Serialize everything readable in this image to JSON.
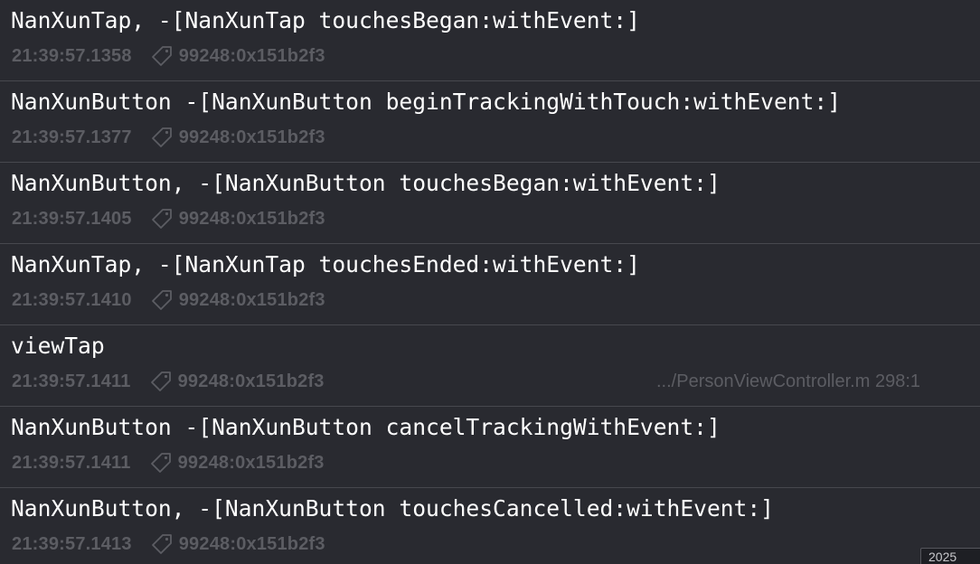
{
  "console": {
    "entries": [
      {
        "message": "NanXunTap, -[NanXunTap touchesBegan:withEvent:]",
        "timestamp": "21:39:57.1358",
        "process": "99248:0x151b2f3",
        "source": ""
      },
      {
        "message": "NanXunButton -[NanXunButton beginTrackingWithTouch:withEvent:]",
        "timestamp": "21:39:57.1377",
        "process": "99248:0x151b2f3",
        "source": ""
      },
      {
        "message": "NanXunButton, -[NanXunButton touchesBegan:withEvent:]",
        "timestamp": "21:39:57.1405",
        "process": "99248:0x151b2f3",
        "source": ""
      },
      {
        "message": "NanXunTap, -[NanXunTap touchesEnded:withEvent:]",
        "timestamp": "21:39:57.1410",
        "process": "99248:0x151b2f3",
        "source": ""
      },
      {
        "message": "viewTap",
        "timestamp": "21:39:57.1411",
        "process": "99248:0x151b2f3",
        "source": ".../PersonViewController.m 298:1"
      },
      {
        "message": "NanXunButton -[NanXunButton cancelTrackingWithEvent:]",
        "timestamp": "21:39:57.1411",
        "process": "99248:0x151b2f3",
        "source": ""
      },
      {
        "message": "NanXunButton, -[NanXunButton touchesCancelled:withEvent:]",
        "timestamp": "21:39:57.1413",
        "process": "99248:0x151b2f3",
        "source": ""
      }
    ],
    "corner_field_text": "2025",
    "tag_icon": "tag-icon"
  },
  "colors": {
    "background": "#292a30",
    "message_text": "#ffffff",
    "meta_text": "#5c5d63",
    "divider": "#47484e"
  }
}
